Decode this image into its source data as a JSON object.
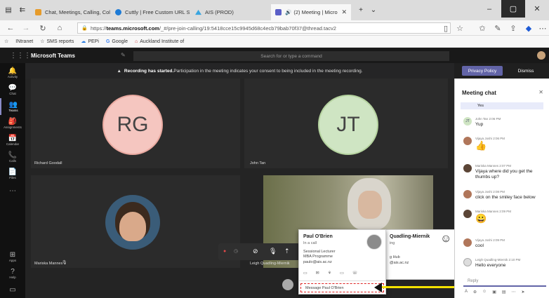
{
  "browser": {
    "tabs": [
      {
        "label": "Chat, Meetings, Calling, Col",
        "color": "#e69b2a"
      },
      {
        "label": "Cuttly | Free Custom URL Sh",
        "color": "#1e7bd6"
      },
      {
        "label": "AIS (PROD)",
        "color": "#3aa5e0"
      },
      {
        "label": "(2) Meeting | Micro",
        "color": "#5b5fc7",
        "active": true
      }
    ],
    "address": {
      "prefix": "https://",
      "host": "teams.microsoft.com",
      "path": "/_#/pre-join-calling/19:5418cce15c9945d68c4ecb79bab70f37@thread.tacv2"
    },
    "favorites": [
      "INtranet",
      "SMS reports",
      "PEPi",
      "Google",
      "Auckland Institute of"
    ]
  },
  "teams": {
    "app_name": "Microsoft Teams",
    "search_placeholder": "Search for or type a command",
    "rail": [
      "Activity",
      "Chat",
      "Teams",
      "Assignments",
      "Calendar",
      "Calls",
      "Files",
      "Apps",
      "Help"
    ],
    "banner": {
      "bold": "Recording has started.",
      "text": " Participation in the meeting indicates your consent to being included in the meeting recording.",
      "privacy_label": "Privacy Policy",
      "dismiss_label": "Dismiss"
    },
    "participants": [
      {
        "initials": "RG",
        "name": "Richard Goodall"
      },
      {
        "initials": "JT",
        "name": "John Tan"
      },
      {
        "name": "Mariska Mannes"
      },
      {
        "name": "Leigh Quadling-Miernik"
      }
    ]
  },
  "chat": {
    "title": "Meeting chat",
    "top_text": "Yes",
    "messages": [
      {
        "author": "John Tan",
        "time": "2:06 PM",
        "text": "Yup",
        "initials": "JT"
      },
      {
        "author": "Vijaya Joshi",
        "time": "2:06 PM",
        "text": "👍"
      },
      {
        "author": "Mariska Mannes",
        "time": "2:07 PM",
        "text": "Vijaya where did you get the thumbs up?"
      },
      {
        "author": "Vijaya Joshi",
        "time": "2:08 PM",
        "text": "click on the smiley face below"
      },
      {
        "author": "Mariska Mannes",
        "time": "2:09 PM",
        "text": "😀"
      },
      {
        "author": "Vijaya Joshi",
        "time": "2:09 PM",
        "text": "cool"
      },
      {
        "author": "Leigh Quadling-Miernik",
        "time": "2:10 PM",
        "text": "Hello everyone"
      }
    ],
    "reply_placeholder": "Reply"
  },
  "popup": {
    "name": "Paul O'Brien",
    "status": "In a call",
    "title1": "Sessional Lecturer",
    "title2": "MBA Programme",
    "email": "paulo@ais.ac.nz",
    "message_label": "Message Paul O'Brien"
  },
  "popup2": {
    "name": "Quadling-Miernik",
    "line2": "ing",
    "line3": "g Hub",
    "email": "@ais.ac.nz"
  }
}
